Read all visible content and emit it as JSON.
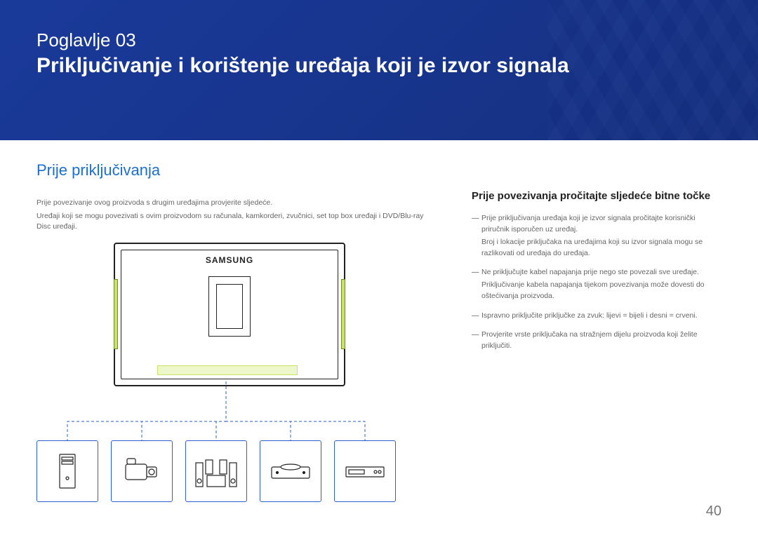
{
  "header": {
    "chapter_label": "Poglavlje  03",
    "chapter_title": "Priključivanje i korištenje uređaja koji je izvor signala"
  },
  "main": {
    "section_heading": "Prije priključivanja",
    "intro_line1": "Prije povezivanje ovog proizvoda s drugim uređajima provjerite sljedeće.",
    "intro_line2": "Uređaji koji se mogu povezivati s ovim proizvodom su računala, kamkorderi, zvučnici, set top box uređaji i DVD/Blu-ray Disc uređaji.",
    "brand": "SAMSUNG",
    "devices": [
      "pc-tower",
      "camcorder",
      "speaker-system",
      "dvd-player",
      "set-top-box"
    ]
  },
  "sidebar": {
    "subheading": "Prije povezivanja pročitajte sljedeće bitne točke",
    "notes": [
      {
        "main": "Prije priključivanja uređaja koji je izvor signala pročitajte korisnički priručnik isporučen uz uređaj.",
        "sub": "Broj i lokacije priključaka na uređajima koji su izvor signala mogu se razlikovati od uređaja do uređaja."
      },
      {
        "main": "Ne priključujte kabel napajanja prije nego ste povezali sve uređaje.",
        "sub": "Priključivanje kabela napajanja tijekom povezivanja može dovesti do oštećivanja proizvoda."
      },
      {
        "main": "Ispravno priključite priključke za zvuk: lijevi = bijeli i desni = crveni.",
        "sub": ""
      },
      {
        "main": "Provjerite vrste priključaka na stražnjem dijelu proizvoda koji želite priključiti.",
        "sub": ""
      }
    ]
  },
  "page_number": "40"
}
